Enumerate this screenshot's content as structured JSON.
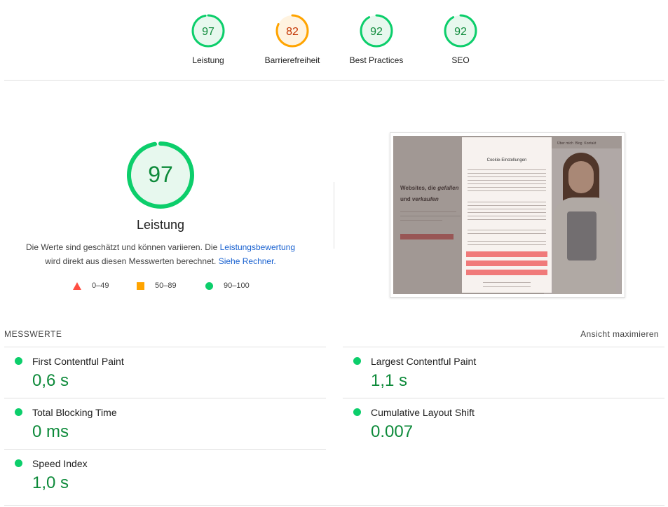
{
  "categories": [
    {
      "label": "Leistung",
      "score": 97,
      "rating": "pass",
      "color": "#0cce6b",
      "text_color": "#0d8a3a",
      "fill": "#e7f8ee"
    },
    {
      "label": "Barrierefreiheit",
      "score": 82,
      "rating": "average",
      "color": "#ffa400",
      "text_color": "#c33300",
      "fill": "#fff3e0"
    },
    {
      "label": "Best Practices",
      "score": 92,
      "rating": "pass",
      "color": "#0cce6b",
      "text_color": "#0d8a3a",
      "fill": "#e7f8ee"
    },
    {
      "label": "SEO",
      "score": 92,
      "rating": "pass",
      "color": "#0cce6b",
      "text_color": "#0d8a3a",
      "fill": "#e7f8ee"
    }
  ],
  "performance": {
    "score": 97,
    "title": "Leistung",
    "description_before": "Die Werte sind geschätzt und können variieren. Die",
    "link_scoring": "Leistungsbewertung",
    "description_middle": "wird direkt aus diesen Messwerten berechnet.",
    "link_calculator": "Siehe Rechner."
  },
  "legend": [
    {
      "range": "0–49",
      "shape": "triangle-icon",
      "color": "#ff4e42"
    },
    {
      "range": "50–89",
      "shape": "square-icon",
      "color": "#ffa400"
    },
    {
      "range": "90–100",
      "shape": "circle-icon",
      "color": "#0cce6b"
    }
  ],
  "screenshot": {
    "modal_title": "Cookie-Einstellungen",
    "nav_items": [
      "Über mich",
      "Blog",
      "Kontakt"
    ],
    "headline_1": "Websites, die",
    "headline_1_script": "gefallen",
    "headline_2": "und",
    "headline_2_script": "verkaufen"
  },
  "metrics": {
    "section_title": "MESSWERTE",
    "expand_label": "Ansicht maximieren",
    "items": [
      {
        "label": "First Contentful Paint",
        "value": "0,6 s"
      },
      {
        "label": "Largest Contentful Paint",
        "value": "1,1 s"
      },
      {
        "label": "Total Blocking Time",
        "value": "0 ms"
      },
      {
        "label": "Cumulative Layout Shift",
        "value": "0.007"
      },
      {
        "label": "Speed Index",
        "value": "1,0 s"
      }
    ]
  }
}
